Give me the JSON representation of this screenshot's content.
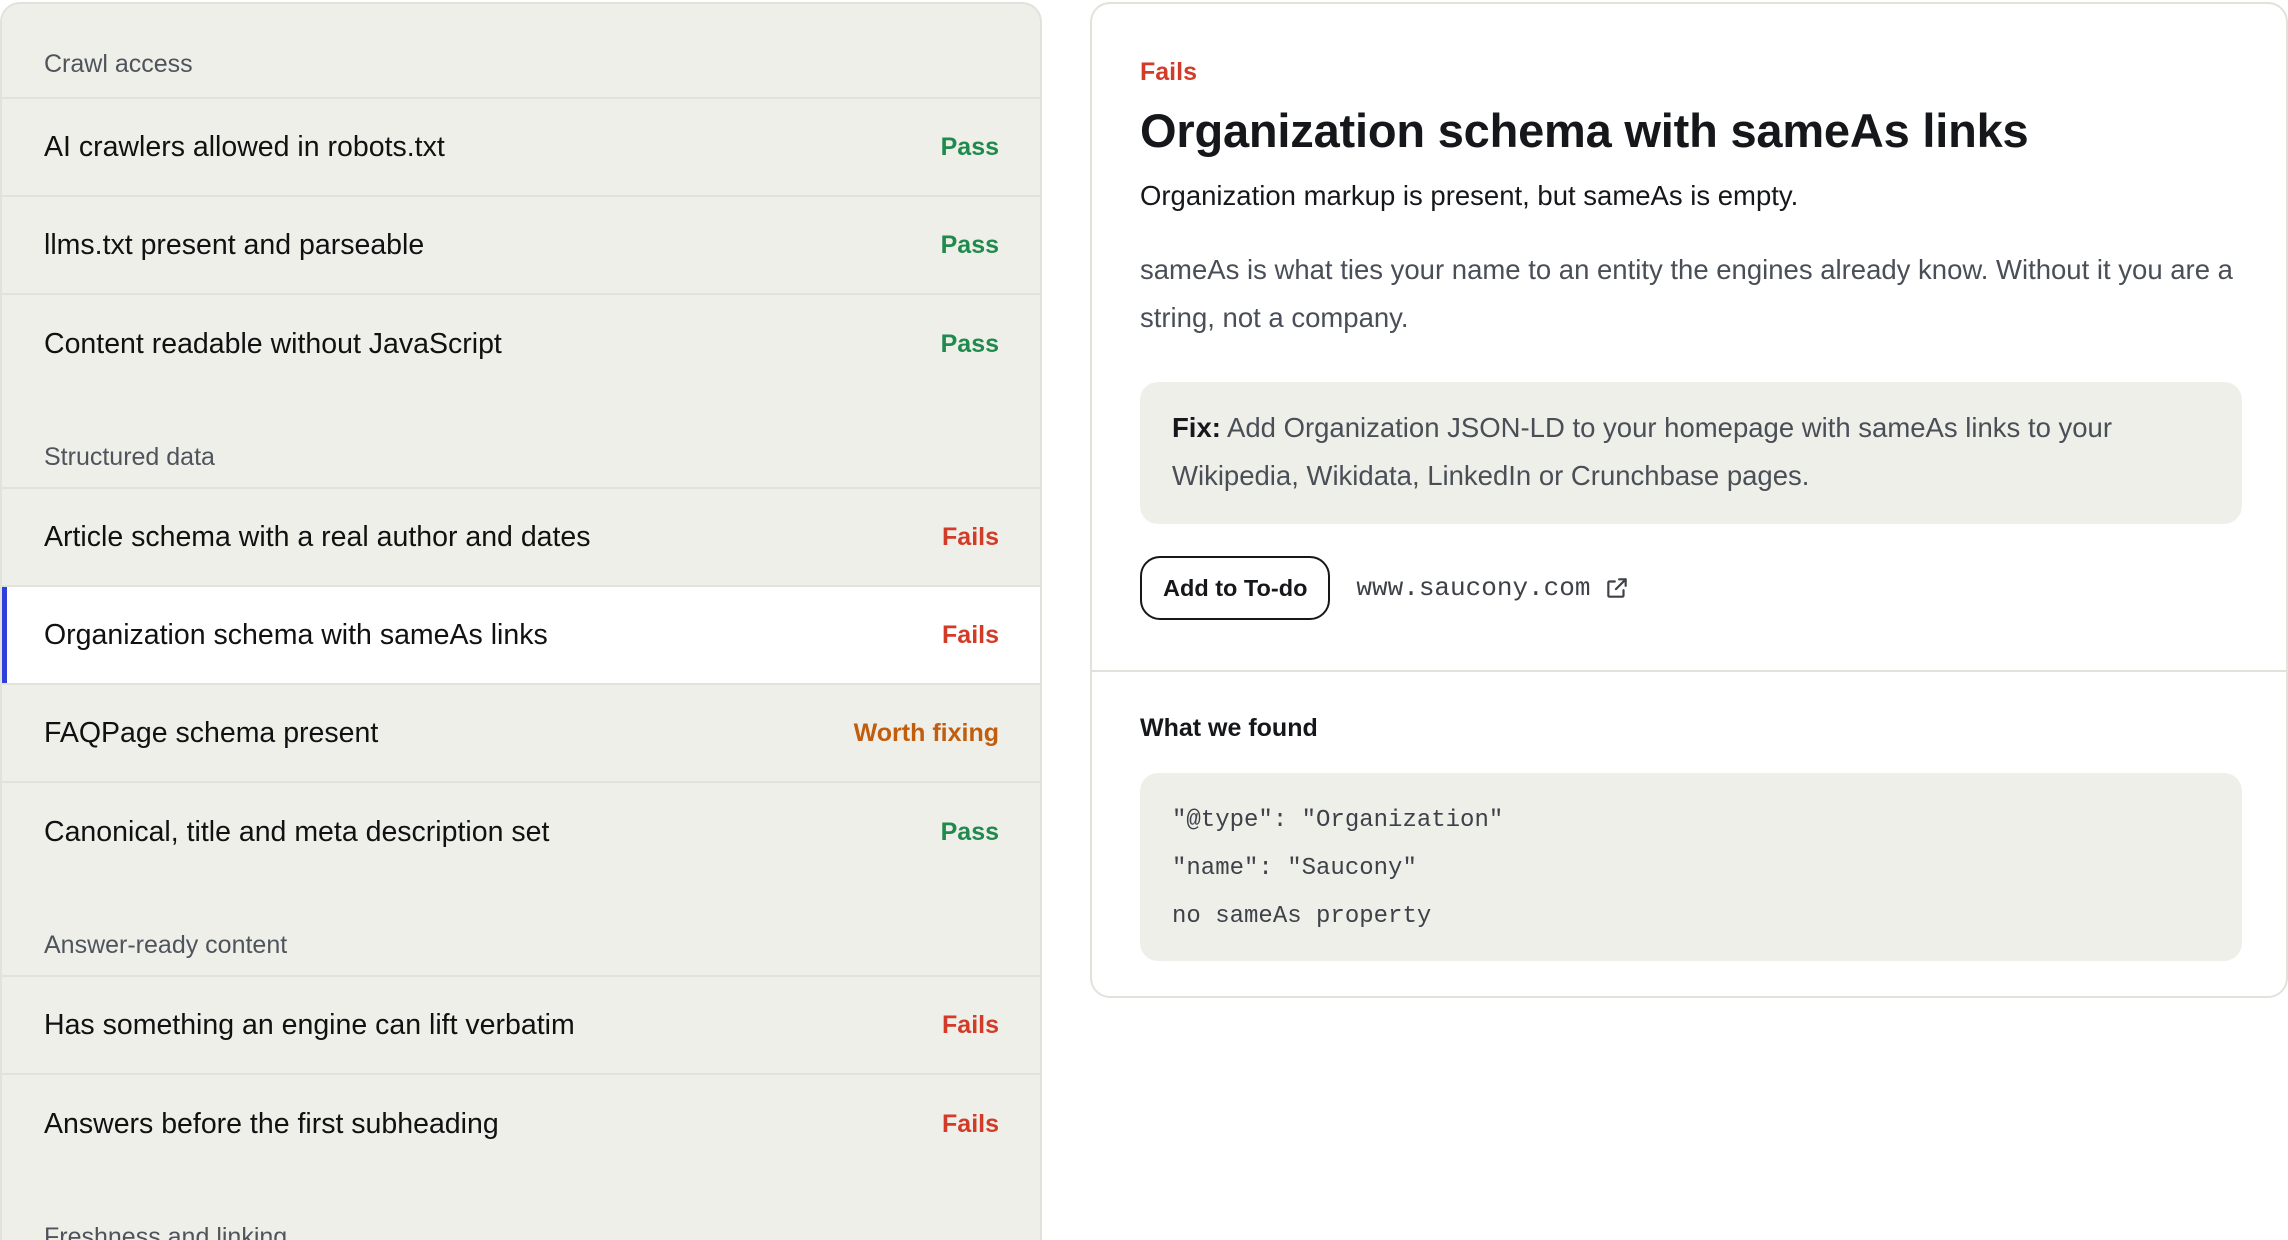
{
  "checklist": {
    "sections": [
      {
        "title": "Crawl access",
        "items": [
          {
            "label": "AI crawlers allowed in robots.txt",
            "status": "Pass"
          },
          {
            "label": "llms.txt present and parseable",
            "status": "Pass"
          },
          {
            "label": "Content readable without JavaScript",
            "status": "Pass"
          }
        ]
      },
      {
        "title": "Structured data",
        "items": [
          {
            "label": "Article schema with a real author and dates",
            "status": "Fails"
          },
          {
            "label": "Organization schema with sameAs links",
            "status": "Fails"
          },
          {
            "label": "FAQPage schema present",
            "status": "Worth fixing"
          },
          {
            "label": "Canonical, title and meta description set",
            "status": "Pass"
          }
        ]
      },
      {
        "title": "Answer-ready content",
        "items": [
          {
            "label": "Has something an engine can lift verbatim",
            "status": "Fails"
          },
          {
            "label": "Answers before the first subheading",
            "status": "Fails"
          }
        ]
      },
      {
        "title": "Freshness and linking",
        "items": []
      }
    ]
  },
  "detail": {
    "verdict": "Fails",
    "title": "Organization schema with sameAs links",
    "summary": "Organization markup is present, but sameAs is empty.",
    "body": "sameAs is what ties your name to an entity the engines already know. Without it you are a string, not a company.",
    "fix_label": "Fix:",
    "fix_text": "Add Organization JSON-LD to your homepage with sameAs links to your Wikipedia, Wikidata, LinkedIn or Crunchbase pages.",
    "todo_button": "Add to To-do",
    "site": "www.saucony.com",
    "site_icon": "external-link-icon",
    "found_title": "What we found",
    "found_lines": [
      "\"@type\": \"Organization\"",
      "\"name\": \"Saucony\"",
      "no sameAs property"
    ]
  },
  "colors": {
    "pass": "#1f8a4c",
    "fail": "#d13b27",
    "worth_fixing": "#c15d0c",
    "selected_accent": "#2f3fd8"
  }
}
